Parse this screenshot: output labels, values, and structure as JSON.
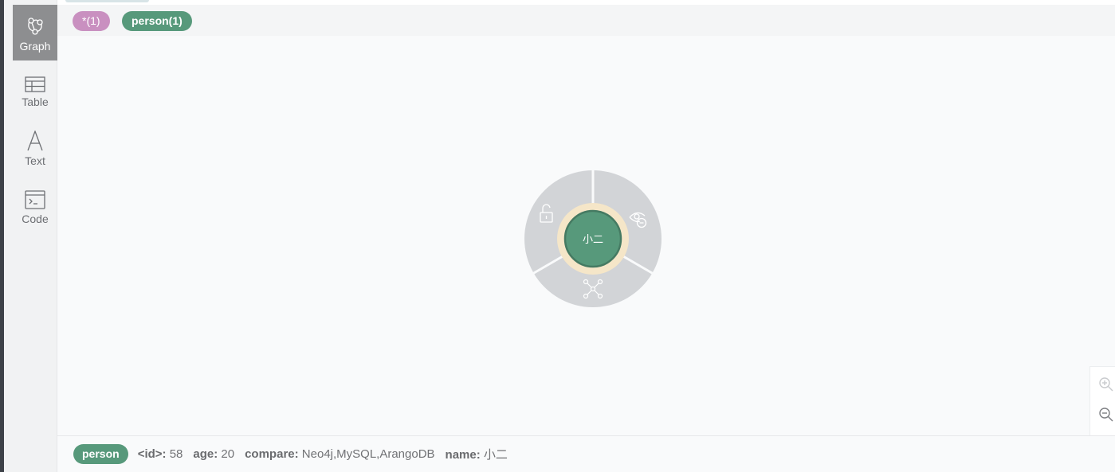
{
  "sidebar": {
    "items": [
      {
        "label": "Graph",
        "icon": "graph-icon",
        "active": true
      },
      {
        "label": "Table",
        "icon": "table-icon",
        "active": false
      },
      {
        "label": "Text",
        "icon": "text-icon",
        "active": false
      },
      {
        "label": "Code",
        "icon": "code-icon",
        "active": false
      }
    ]
  },
  "legend": {
    "all_label": "*(1)",
    "person_label": "person(1)"
  },
  "graph": {
    "node": {
      "caption": "小二",
      "color": "#57997b",
      "ring_color": "#f5e6c8"
    },
    "wheel_actions": [
      {
        "icon": "unlock-icon",
        "action": "unlock node"
      },
      {
        "icon": "eye-hide-icon",
        "action": "hide node"
      },
      {
        "icon": "expand-relationships-icon",
        "action": "expand node"
      }
    ]
  },
  "zoom": {
    "zoom_in_icon": "zoom-in-icon",
    "zoom_out_icon": "zoom-out-icon"
  },
  "status": {
    "label": "person",
    "props": [
      {
        "key": "<id>:",
        "value": "58"
      },
      {
        "key": "age:",
        "value": "20"
      },
      {
        "key": "compare:",
        "value": "Neo4j,MySQL,ArangoDB"
      },
      {
        "key": "name:",
        "value": "小二"
      }
    ]
  },
  "colors": {
    "person": "#57997b",
    "all": "#c990c0",
    "sidebar_active": "#8d8e90"
  }
}
